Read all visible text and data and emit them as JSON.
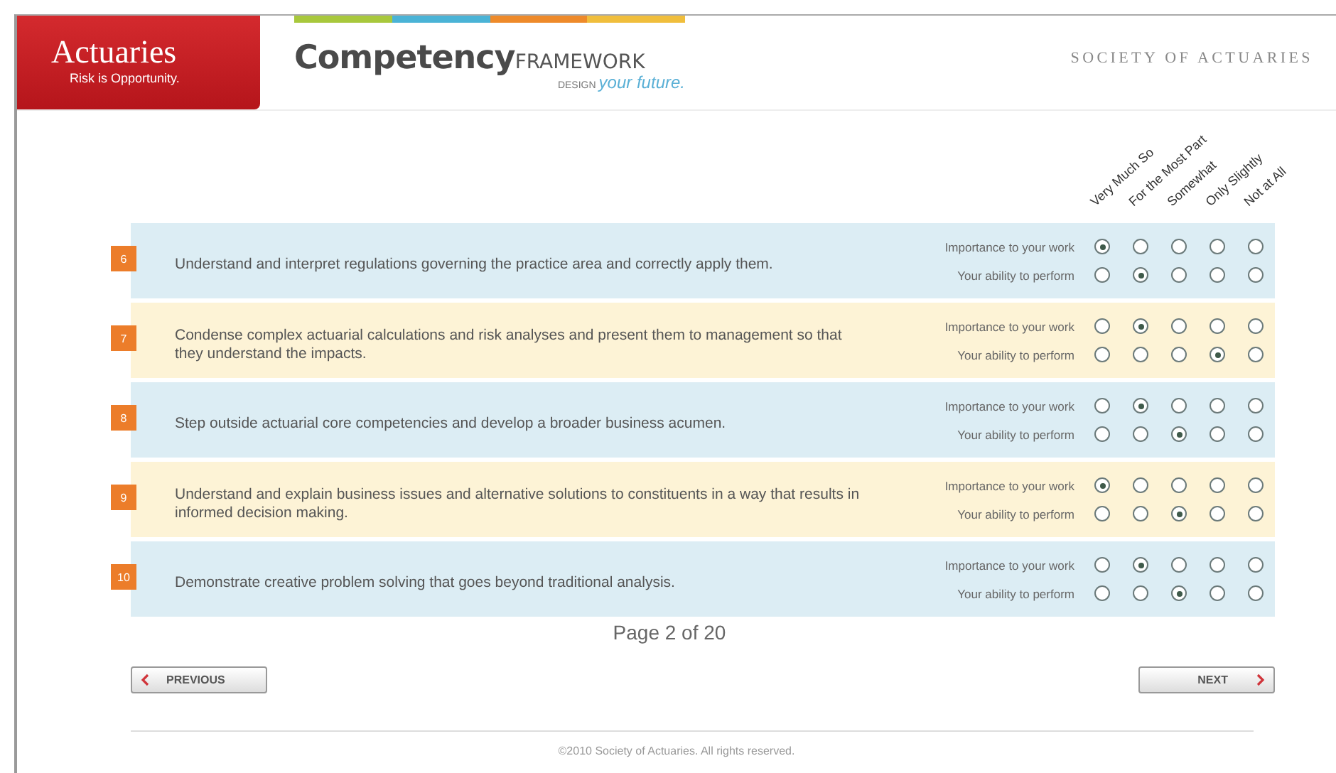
{
  "header": {
    "logo_title": "Actuaries",
    "logo_tagline": "Risk is Opportunity.",
    "brand": "Competency",
    "brand_suffix": "FRAMEWORK",
    "slogan_prefix": "DESIGN",
    "slogan": "your future.",
    "organization": "SOCIETY OF ACTUARIES"
  },
  "rating_columns": [
    "Very Much So",
    "For the Most Part",
    "Somewhat",
    "Only Slightly",
    "Not at All"
  ],
  "questions": [
    {
      "number": "6",
      "text": "Understand and interpret regulations governing the practice area and correctly apply them.",
      "scales": [
        {
          "label": "Importance to your work",
          "options": [
            {
              "selected": true
            },
            {
              "selected": false
            },
            {
              "selected": false
            },
            {
              "selected": false
            },
            {
              "selected": false
            }
          ]
        },
        {
          "label": "Your ability to perform",
          "options": [
            {
              "selected": false
            },
            {
              "selected": true
            },
            {
              "selected": false
            },
            {
              "selected": false
            },
            {
              "selected": false
            }
          ]
        }
      ]
    },
    {
      "number": "7",
      "text": "Condense complex actuarial calculations and risk analyses and present them to management so that they understand the impacts.",
      "scales": [
        {
          "label": "Importance to your work",
          "options": [
            {
              "selected": false
            },
            {
              "selected": true
            },
            {
              "selected": false
            },
            {
              "selected": false
            },
            {
              "selected": false
            }
          ]
        },
        {
          "label": "Your ability to perform",
          "options": [
            {
              "selected": false
            },
            {
              "selected": false
            },
            {
              "selected": false
            },
            {
              "selected": true
            },
            {
              "selected": false
            }
          ]
        }
      ]
    },
    {
      "number": "8",
      "text": "Step outside actuarial core competencies and develop a broader business acumen.",
      "scales": [
        {
          "label": "Importance to your work",
          "options": [
            {
              "selected": false
            },
            {
              "selected": true
            },
            {
              "selected": false
            },
            {
              "selected": false
            },
            {
              "selected": false
            }
          ]
        },
        {
          "label": "Your ability to perform",
          "options": [
            {
              "selected": false
            },
            {
              "selected": false
            },
            {
              "selected": true
            },
            {
              "selected": false
            },
            {
              "selected": false
            }
          ]
        }
      ]
    },
    {
      "number": "9",
      "text": "Understand and explain business issues and alternative solutions to constituents in a way that results in informed decision making.",
      "scales": [
        {
          "label": "Importance to your work",
          "options": [
            {
              "selected": true
            },
            {
              "selected": false
            },
            {
              "selected": false
            },
            {
              "selected": false
            },
            {
              "selected": false
            }
          ]
        },
        {
          "label": "Your ability to perform",
          "options": [
            {
              "selected": false
            },
            {
              "selected": false
            },
            {
              "selected": true
            },
            {
              "selected": false
            },
            {
              "selected": false
            }
          ]
        }
      ]
    },
    {
      "number": "10",
      "text": "Demonstrate creative problem solving that goes beyond traditional analysis.",
      "scales": [
        {
          "label": "Importance to your work",
          "options": [
            {
              "selected": false
            },
            {
              "selected": true
            },
            {
              "selected": false
            },
            {
              "selected": false
            },
            {
              "selected": false
            }
          ]
        },
        {
          "label": "Your ability to perform",
          "options": [
            {
              "selected": false
            },
            {
              "selected": false
            },
            {
              "selected": true
            },
            {
              "selected": false
            },
            {
              "selected": false
            }
          ]
        }
      ]
    }
  ],
  "pager": "Page 2 of 20",
  "buttons": {
    "previous": "PREVIOUS",
    "next": "NEXT"
  },
  "footer": "©2010 Society of Actuaries. All rights reserved."
}
